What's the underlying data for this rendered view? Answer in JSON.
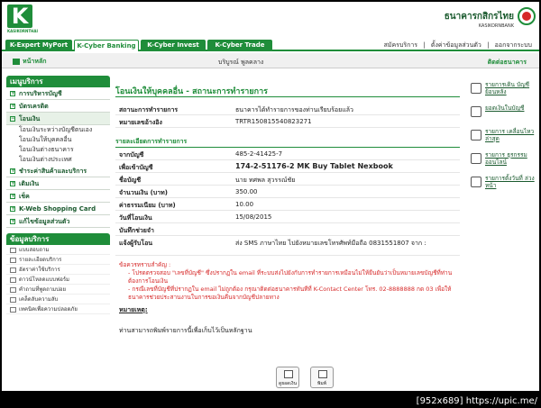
{
  "header": {
    "logo_letter": "K",
    "logo_text": "KASIKORNTHAI",
    "bank_name_th": "ธนาคารกสิกรไทย",
    "bank_name_en": "KASIKORNBANK"
  },
  "tabs": [
    "K-Expert MyPort",
    "K-Cyber Banking",
    "K-Cyber Invest",
    "K-Cyber Trade"
  ],
  "toplinks": [
    "สมัครบริการ",
    "|",
    "ตั้งค่าข้อมูลส่วนตัว",
    "|",
    "ออกจากระบบ"
  ],
  "subbar": {
    "home": "หน้าหลัก",
    "company": "บริบูรณ์ พูลคลาง",
    "contact": "ติดต่อธนาคาร"
  },
  "sidebar": {
    "menu_title": "เมนูบริการ",
    "items": [
      {
        "label": "การบริหารบัญชี"
      },
      {
        "label": "บัตรเครดิต"
      },
      {
        "label": "โอนเงิน"
      }
    ],
    "subitems": [
      "โอนเงินระหว่างบัญชีตนเอง",
      "โอนเงินให้บุคคลอื่น",
      "โอนเงินต่างธนาคาร",
      "โอนเงินต่างประเทศ"
    ],
    "items2": [
      {
        "label": "ชำระค่าสินค้าและบริการ"
      },
      {
        "label": "เติมเงิน"
      },
      {
        "label": "เช็ค"
      },
      {
        "label": "K-Web Shopping Card"
      },
      {
        "label": "แก้ไขข้อมูลส่วนตัว"
      }
    ],
    "service_title": "ข้อมูลบริการ",
    "services": [
      "แบบสอบถาม",
      "รายละเอียดบริการ",
      "อัตราค่าใช้บริการ",
      "ดาวน์โหลดแบบฟอร์ม",
      "คำถามที่พูดถามบ่อย",
      "เคล็ดลับความลับ",
      "เทคนิคเพื่อความปลอดภัย"
    ]
  },
  "main": {
    "title": "โอนเงินให้บุคคลอื่น - สถานะการทำรายการ",
    "rows": [
      {
        "label": "สถานะการทำรายการ",
        "value": "ธนาคารได้ทำรายการของท่านเรียบร้อยแล้ว"
      },
      {
        "label": "หมายเลขอ้างอิง",
        "value": "TRTR150815540823271"
      }
    ],
    "section": "รายละเอียดการทำรายการ",
    "details": [
      {
        "label": "จากบัญชี",
        "value": "485-2-41425-7",
        "bold": false
      },
      {
        "label": "เพื่อเข้าบัญชี",
        "value": "174-2-51176-2 MK Buy Tablet Nexbook",
        "bold": true
      },
      {
        "label": "ชื่อบัญชี",
        "value": "นาย ทศพล สุวรรณ์ชัย",
        "bold": false
      },
      {
        "label": "จำนวนเงิน (บาท)",
        "value": "350.00",
        "bold": false
      },
      {
        "label": "ค่าธรรมเนียม (บาท)",
        "value": "10.00",
        "bold": false
      },
      {
        "label": "วันที่โอนเงิน",
        "value": "15/08/2015",
        "bold": false
      },
      {
        "label": "บันทึกช่วยจำ",
        "value": "",
        "bold": false
      },
      {
        "label": "แจ้งผู้รับโอน",
        "value": "ส่ง SMS ภาษาไทย ไปยังหมายเลขโทรศัพท์มือถือ 0831551807 จาก :",
        "bold": false
      }
    ],
    "notes": [
      "ข้อควรทราบสำคัญ :",
      "- โปรดตรวจสอบ \"เลขที่บัญชี\" ซึ่งปรากฏใน email ที่ระบบส่งไปยังกับการทำรายการเหมือนไม่ให้ยืนยันว่าเป็นหมายเลขบัญชีที่ท่านต้องการโอนเงิน",
      "- กรณีเลขที่บัญชีที่ปรากฏใน email ไม่ถูกต้อง กรุณาติดต่อธนาคารทันทีที่ K-Contact Center โทร. 02-8888888 กด 03 เพื่อให้ธนาคารช่วยประสานงานในการขอเงินคืนจากบัญชีปลายทาง"
    ],
    "memo": "หมายเหตุ:",
    "hint": "ท่านสามารถพิมพ์รายการนี้เพื่อเก็บไว้เป็นหลักฐาน"
  },
  "buttons": [
    "ดูยอดเงิน",
    "พิมพ์"
  ],
  "right": [
    "รายการเดิน บัญชีย้อนหลัง",
    "ยอดเงินในบัญชี",
    "รายการ เคลื่อนไหวล่าสุด",
    "รายการ ธุรกรรมออนไลน์",
    "รายการตั้งวันที่ ล่วงหน้า"
  ],
  "url_text": "[952x689] https://upic.me/",
  "colors": {
    "brand_green": "#1f8d3a",
    "alert_red": "#d62828"
  }
}
